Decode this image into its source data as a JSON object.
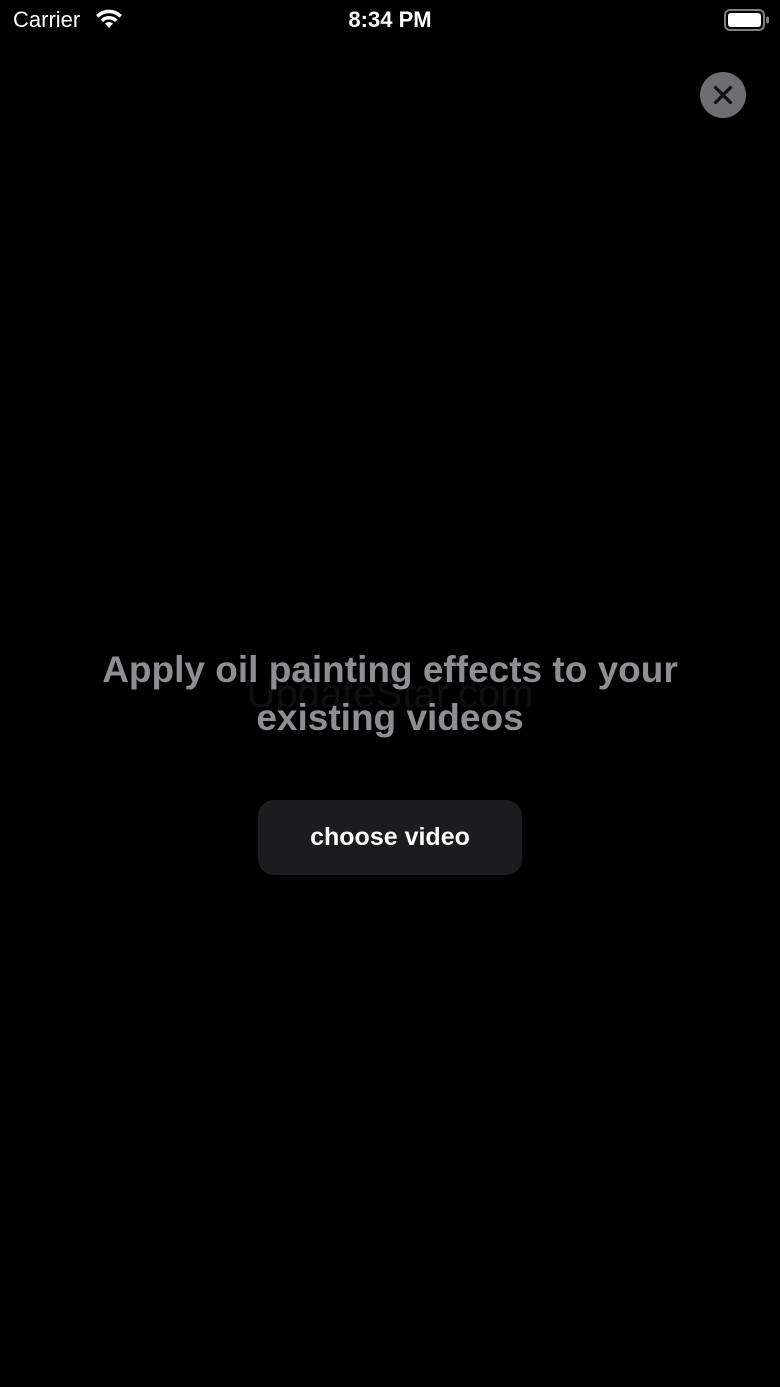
{
  "status_bar": {
    "carrier": "Carrier",
    "time": "8:34 PM"
  },
  "icons": {
    "wifi": "wifi-icon",
    "battery": "battery-icon",
    "close": "close-icon"
  },
  "main": {
    "headline": "Apply oil painting effects to your existing videos",
    "choose_button_label": "choose video",
    "watermark": "UpdateStar.com"
  },
  "colors": {
    "background": "#000000",
    "close_button": "#6e6e72",
    "headline_text": "#8e8e93",
    "choose_button_bg": "#1c1c1e"
  }
}
